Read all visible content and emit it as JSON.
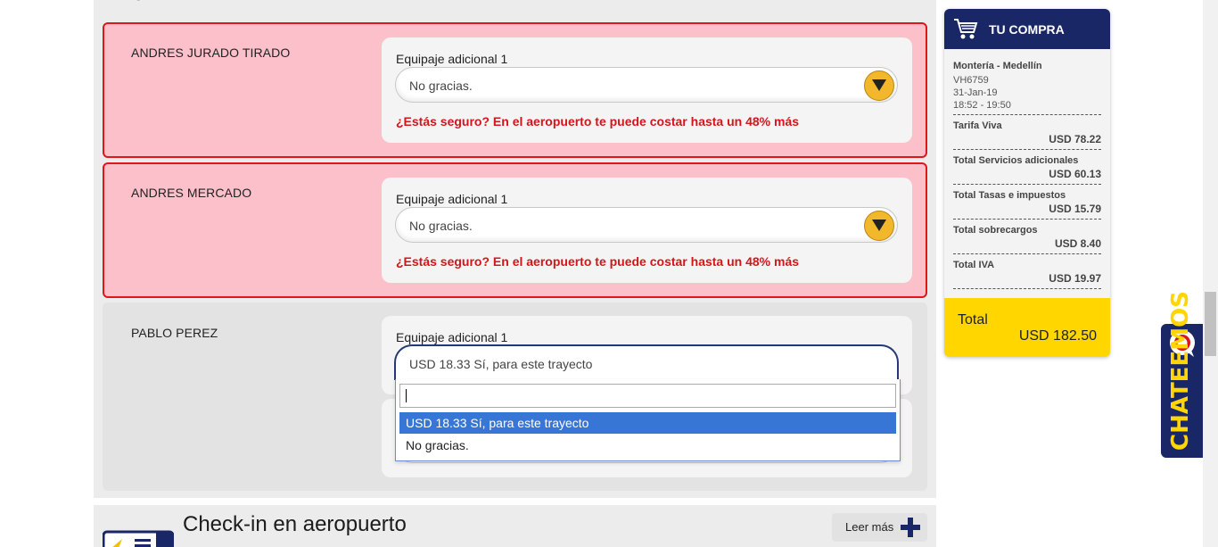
{
  "passengers": [
    {
      "name": "ANDRES JURADO TIRADO",
      "bag_label": "Equipaje adicional 1",
      "selected": "No gracias.",
      "warning": "¿Estás seguro? En el aeropuerto te puede costar hasta un 48% más"
    },
    {
      "name": "ANDRES MERCADO",
      "bag_label": "Equipaje adicional 1",
      "selected": "No gracias.",
      "warning": "¿Estás seguro? En el aeropuerto te puede costar hasta un 48% más"
    },
    {
      "name": "PABLO PEREZ",
      "bag_label": "Equipaje adicional 1",
      "selected": "USD 18.33 Sí, para este trayecto"
    }
  ],
  "dropdown": {
    "search_value": "",
    "options": [
      "USD 18.33 Sí, para este trayecto",
      "No gracias."
    ],
    "highlighted_index": 0
  },
  "checkin": {
    "title": "Check-in en aeropuerto",
    "more_label": "Leer más"
  },
  "cart": {
    "title": "TU COMPRA",
    "route": "Montería - Medellín",
    "flight": "VH6759",
    "date": "31-Jan-19",
    "time": "18:52 - 19:50",
    "items": [
      {
        "label": "Tarifa Viva",
        "value": "USD 78.22"
      },
      {
        "label": "Total Servicios adicionales",
        "value": "USD 60.13"
      },
      {
        "label": "Total Tasas e impuestos",
        "value": "USD 15.79"
      },
      {
        "label": "Total sobrecargos",
        "value": "USD 8.40"
      },
      {
        "label": "Total IVA",
        "value": "USD 19.97"
      }
    ],
    "total_label": "Total",
    "total_value": "USD 182.50"
  },
  "chat": {
    "label": "CHATEEMOS"
  },
  "colors": {
    "brand_navy": "#1a2766",
    "brand_yellow": "#ffd600",
    "warning_red": "#d4151b",
    "warning_bg": "#fbc0c9",
    "option_highlight": "#3876d6"
  }
}
